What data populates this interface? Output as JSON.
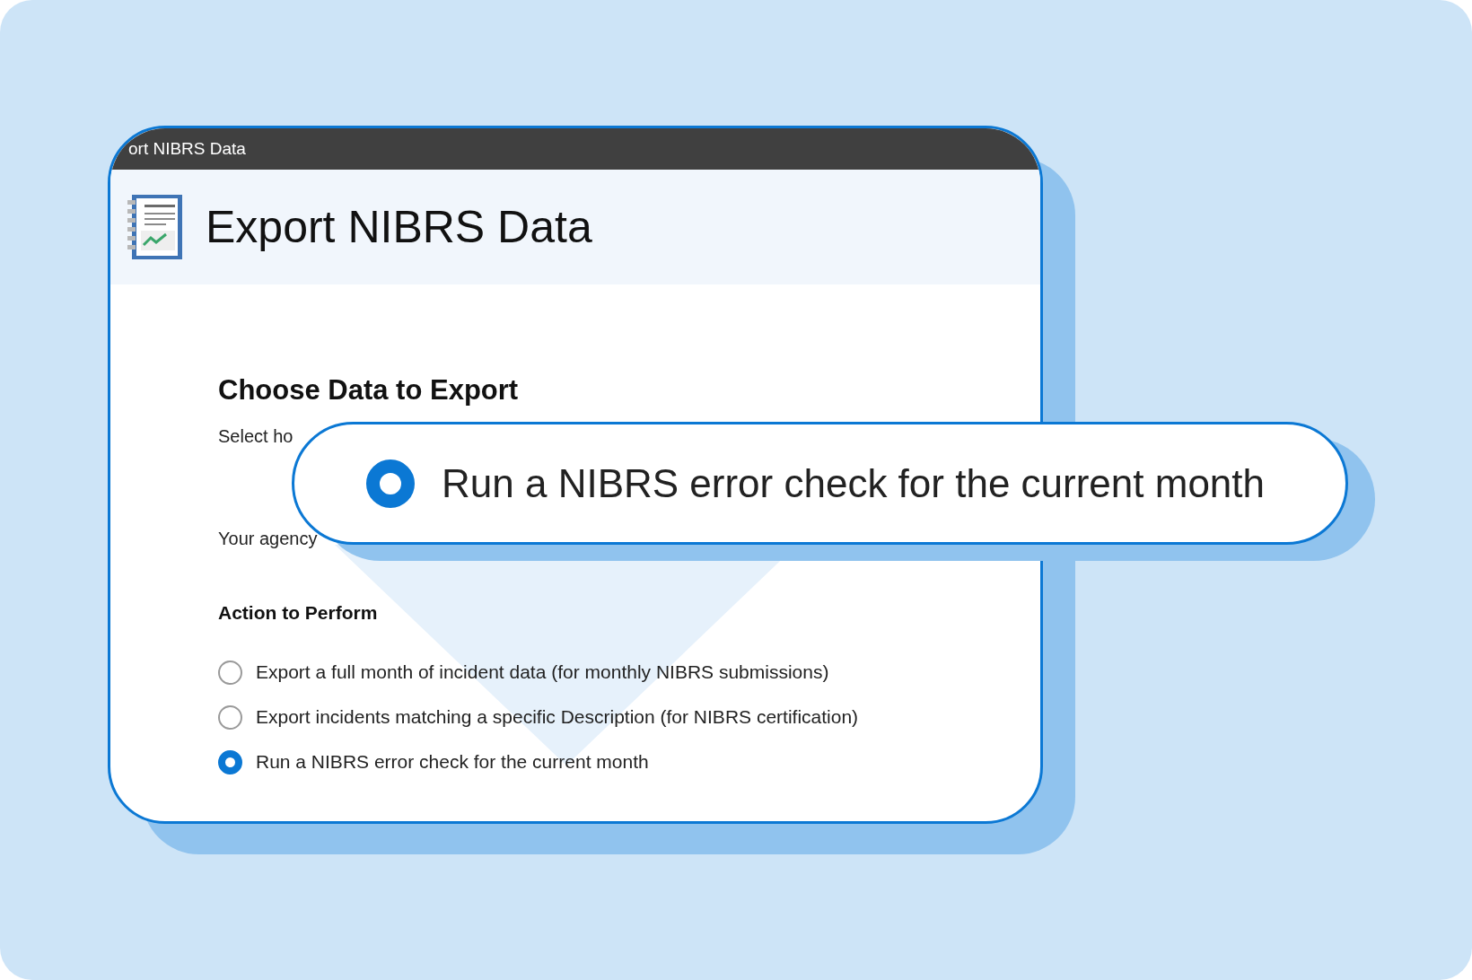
{
  "window": {
    "title": "ort NIBRS Data",
    "heading": "Export NIBRS Data"
  },
  "section": {
    "title": "Choose Data to Export",
    "instruction": "Select ho",
    "start_month_note": "Your agency"
  },
  "action": {
    "title": "Action to Perform",
    "options": [
      {
        "label": "Export a full month of incident data (for monthly NIBRS submissions)",
        "selected": false
      },
      {
        "label": "Export incidents matching a specific Description (for NIBRS certification)",
        "selected": false
      },
      {
        "label": "Run a NIBRS error check for the current month",
        "selected": true
      }
    ]
  },
  "callout": {
    "label": "Run a NIBRS error check for the current month",
    "selected": true
  }
}
